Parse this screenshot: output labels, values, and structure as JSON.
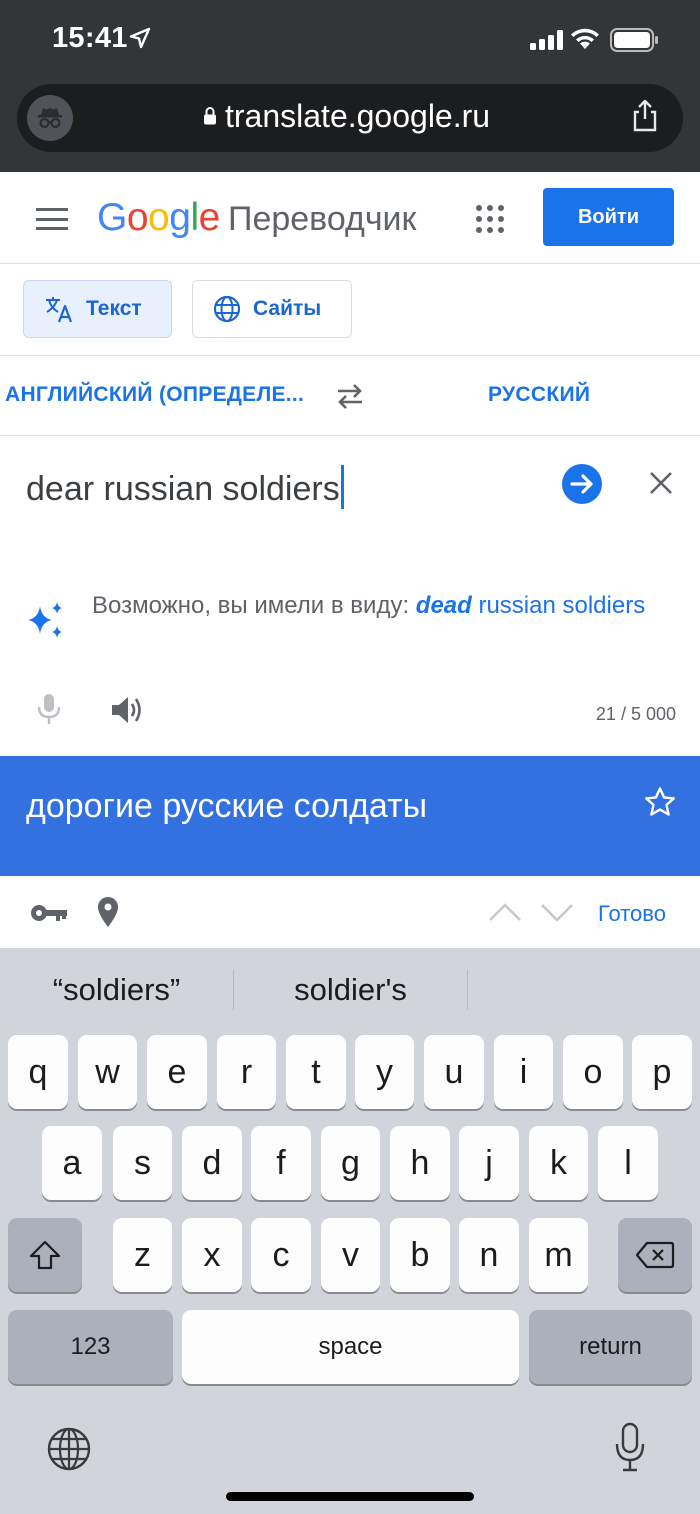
{
  "status_bar": {
    "time": "15:41"
  },
  "browser": {
    "url": "translate.google.ru"
  },
  "header": {
    "logo_letters": [
      "G",
      "o",
      "o",
      "g",
      "l",
      "e"
    ],
    "product_name": "Переводчик",
    "signin_label": "Войти"
  },
  "modes": {
    "text_label": "Текст",
    "sites_label": "Сайты"
  },
  "languages": {
    "source": "АНГЛИЙСКИЙ (ОПРЕДЕЛЕ...",
    "target": "РУССКИЙ"
  },
  "source": {
    "text": "dear russian soldiers",
    "suggestion_prefix": "Возможно, вы имели в виду:",
    "suggestion_fix": "dead",
    "suggestion_rest": "russian soldiers",
    "char_count": "21 / 5 000"
  },
  "translation": {
    "text": "дорогие русские солдаты"
  },
  "accessory": {
    "done_label": "Готово"
  },
  "keyboard": {
    "predictions": [
      "“soldiers”",
      "soldier's"
    ],
    "row1": [
      "q",
      "w",
      "e",
      "r",
      "t",
      "y",
      "u",
      "i",
      "o",
      "p"
    ],
    "row2": [
      "a",
      "s",
      "d",
      "f",
      "g",
      "h",
      "j",
      "k",
      "l"
    ],
    "row3": [
      "z",
      "x",
      "c",
      "v",
      "b",
      "n",
      "m"
    ],
    "numbers_label": "123",
    "space_label": "space",
    "return_label": "return"
  },
  "colors": {
    "accent": "#1a73e8",
    "result_bg": "#3371e1",
    "keyboard_bg": "#d1d4db"
  }
}
